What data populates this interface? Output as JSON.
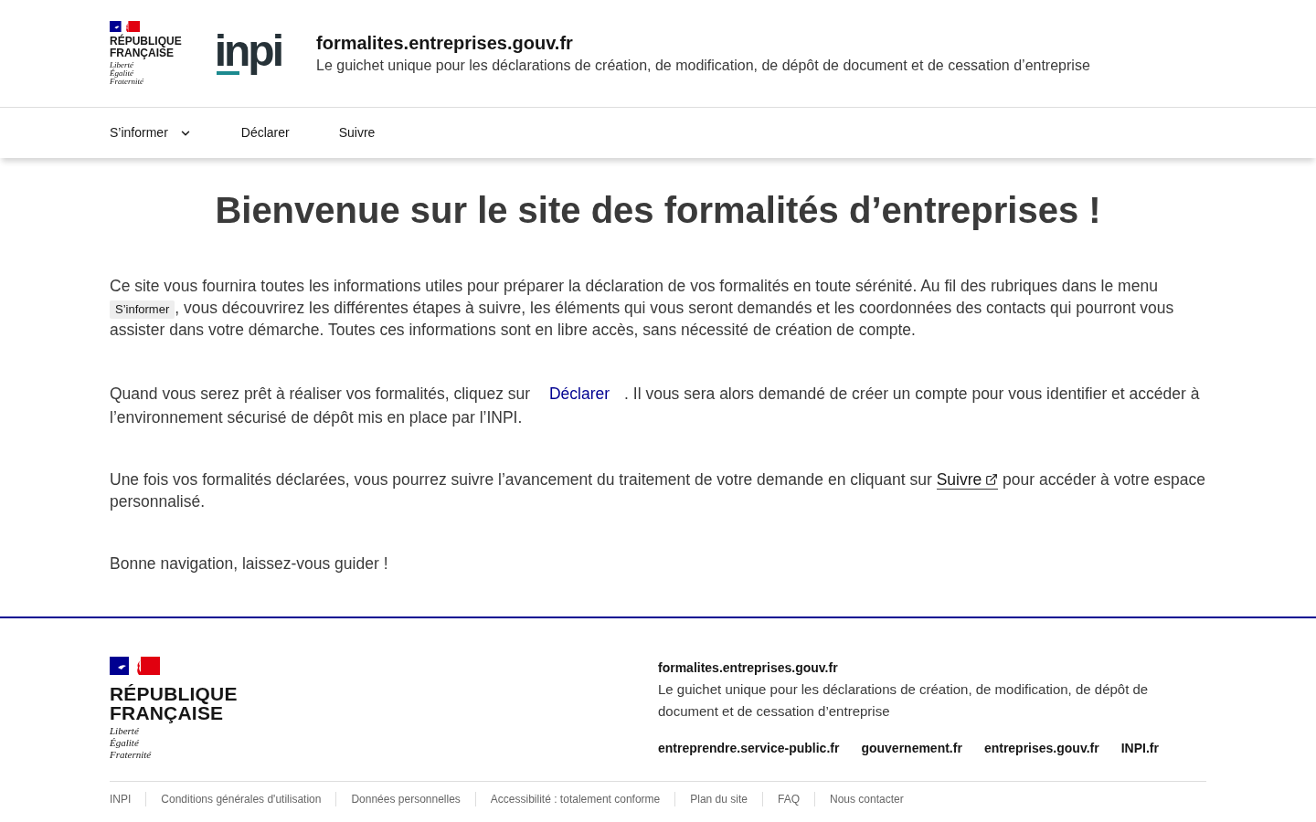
{
  "header": {
    "emblem": {
      "title_lines": [
        "RÉPUBLIQUE",
        "FRANÇAISE"
      ],
      "motto_lines": [
        "Liberté",
        "Égalité",
        "Fraternité"
      ]
    },
    "logo": "inpi",
    "site": {
      "title": "formalites.entreprises.gouv.fr",
      "tagline": "Le guichet unique pour les déclarations de création, de modification, de dépôt de document et de cessation d’entreprise"
    }
  },
  "nav": [
    {
      "label": "S’informer",
      "kind": "menu",
      "expanded": false
    },
    {
      "label": "Déclarer",
      "kind": "link"
    },
    {
      "label": "Suivre",
      "kind": "link"
    }
  ],
  "main": {
    "heading": "Bienvenue sur le site des formalités d’entreprises !",
    "paragraphs": [
      {
        "segments": [
          {
            "kind": "text",
            "text": "Ce site vous fournira toutes les informations utiles pour préparer la déclaration de vos formalités en toute sérénité. Au fil des rubriques dans le menu "
          },
          {
            "kind": "tag",
            "text": "S’informer"
          },
          {
            "kind": "text",
            "text": ", vous découvrirez les différentes étapes à suivre, les éléments qui vous seront demandés et les coordonnées des contacts qui pourront vous assister dans votre démarche. Toutes ces informations sont en libre accès, sans nécessité de création de compte."
          }
        ]
      },
      {
        "segments": [
          {
            "kind": "text",
            "text": "Quand vous serez prêt à réaliser vos formalités, cliquez sur "
          },
          {
            "kind": "button",
            "text": "Déclarer"
          },
          {
            "kind": "text",
            "text": ". Il vous sera alors demandé de créer un compte pour vous identifier et accéder à l’environnement sécurisé de dépôt mis en place par l’INPI."
          }
        ]
      },
      {
        "segments": [
          {
            "kind": "text",
            "text": "Une fois vos formalités déclarées, vous pourrez suivre l’avancement du traitement de votre demande en cliquant sur "
          },
          {
            "kind": "external_link",
            "text": "Suivre"
          },
          {
            "kind": "text",
            "text": " pour accéder à votre espace personnalisé."
          }
        ]
      },
      {
        "segments": [
          {
            "kind": "text",
            "text": "Bonne navigation, laissez-vous guider !"
          }
        ]
      }
    ]
  },
  "footer": {
    "emblem": {
      "title_lines": [
        "RÉPUBLIQUE",
        "FRANÇAISE"
      ],
      "motto_lines": [
        "Liberté",
        "Égalité",
        "Fraternité"
      ]
    },
    "site": {
      "title": "formalites.entreprises.gouv.fr",
      "description": "Le guichet unique pour les déclarations de création, de modification, de dépôt de document et de cessation d’entreprise"
    },
    "links": [
      "entreprendre.service-public.fr",
      "gouvernement.fr",
      "entreprises.gouv.fr",
      "INPI.fr"
    ],
    "bottom_links": [
      "INPI",
      "Conditions générales d'utilisation",
      "Données personnelles",
      "Accessibilité : totalement conforme",
      "Plan du site",
      "FAQ",
      "Nous contacter"
    ]
  }
}
